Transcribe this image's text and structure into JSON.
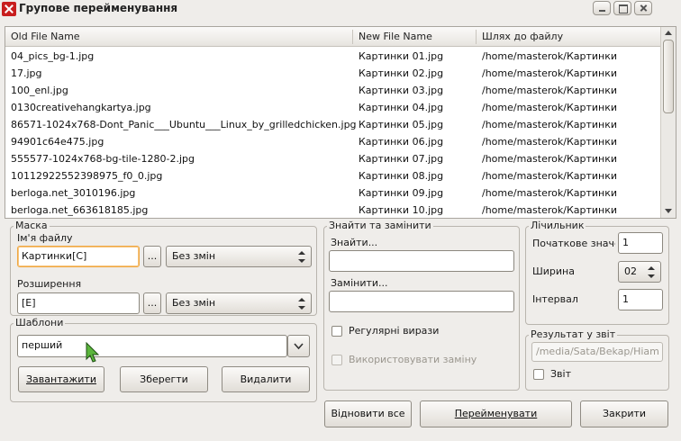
{
  "window": {
    "title": "Групове перейменування"
  },
  "table": {
    "headers": [
      "Old File Name",
      "New File Name",
      "Шлях до файлу"
    ],
    "rows": [
      [
        "04_pics_bg-1.jpg",
        "Картинки 01.jpg",
        "/home/masterok/Картинки"
      ],
      [
        "17.jpg",
        "Картинки 02.jpg",
        "/home/masterok/Картинки"
      ],
      [
        "100_enl.jpg",
        "Картинки 03.jpg",
        "/home/masterok/Картинки"
      ],
      [
        "0130creativehangkartya.jpg",
        "Картинки 04.jpg",
        "/home/masterok/Картинки"
      ],
      [
        "86571-1024x768-Dont_Panic___Ubuntu___Linux_by_grilledchicken.jpg",
        "Картинки 05.jpg",
        "/home/masterok/Картинки"
      ],
      [
        "94901c64e475.jpg",
        "Картинки 06.jpg",
        "/home/masterok/Картинки"
      ],
      [
        "555577-1024x768-bg-tile-1280-2.jpg",
        "Картинки 07.jpg",
        "/home/masterok/Картинки"
      ],
      [
        "10112922552398975_f0_0.jpg",
        "Картинки 08.jpg",
        "/home/masterok/Картинки"
      ],
      [
        "berloga.net_3010196.jpg",
        "Картинки 09.jpg",
        "/home/masterok/Картинки"
      ],
      [
        "berloga.net_663618185.jpg",
        "Картинки 10.jpg",
        "/home/masterok/Картинки"
      ]
    ]
  },
  "mask": {
    "group_label": "Маска",
    "filename_label": "Ім'я файлу",
    "filename_value": "Картинки[C]",
    "filename_combo": "Без змін",
    "ext_label": "Розширення",
    "ext_value": "[E]",
    "ext_combo": "Без змін",
    "ellipsis": "..."
  },
  "templates": {
    "group_label": "Шаблони",
    "value": "перший",
    "load": "Завантажити",
    "save": "Зберегти",
    "delete": "Видалити"
  },
  "find_replace": {
    "group_label": "Знайти та замінити",
    "find_label": "Знайти...",
    "find_value": "",
    "replace_label": "Замінити...",
    "replace_value": "",
    "regex_label": "Регулярні вирази",
    "use_replace_label": "Використовувати заміну"
  },
  "counter": {
    "group_label": "Лічильник",
    "start_label": "Початкове значе",
    "start_value": "1",
    "width_label": "Ширина",
    "width_value": "02",
    "interval_label": "Інтервал",
    "interval_value": "1"
  },
  "report": {
    "group_label": "Результат у звіт",
    "path": "/media/Sata/Bekap/Hiam",
    "checkbox_label": "Звіт"
  },
  "footer": {
    "restore": "Відновити все",
    "rename": "Перейменувати",
    "close": "Закрити"
  }
}
